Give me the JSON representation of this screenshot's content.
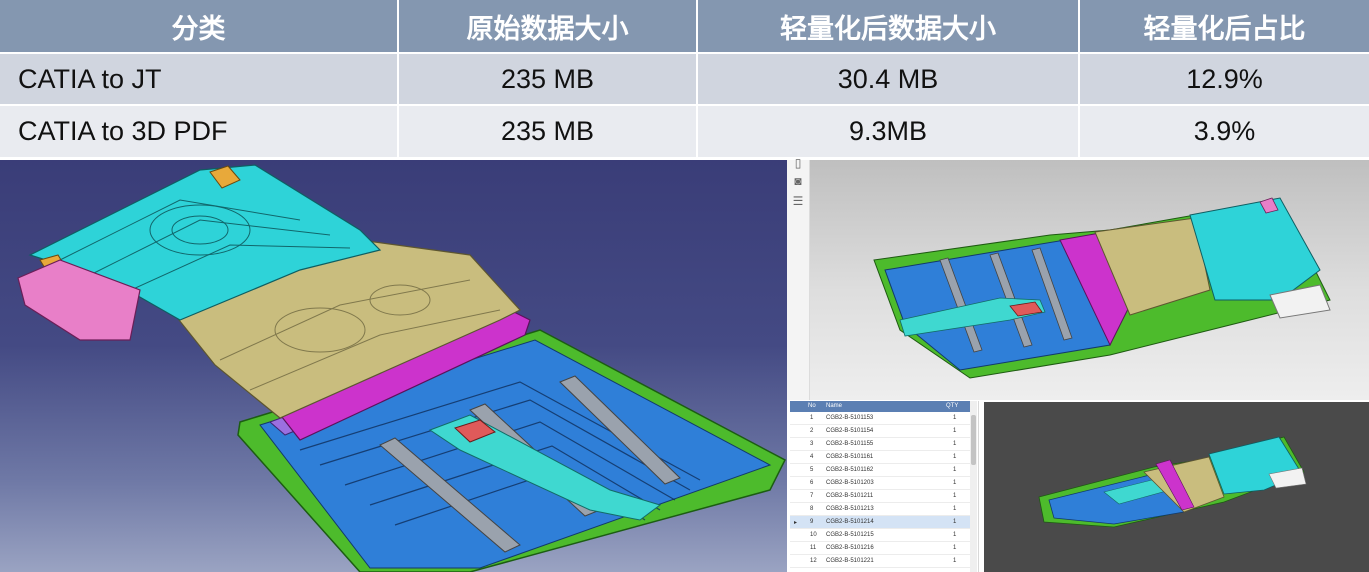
{
  "table": {
    "headers": [
      "分类",
      "原始数据大小",
      "轻量化后数据大小",
      "轻量化后占比"
    ],
    "rows": [
      [
        "CATIA to JT",
        "235 MB",
        "30.4 MB",
        "12.9%"
      ],
      [
        "CATIA to 3D PDF",
        "235 MB",
        "9.3MB",
        "3.9%"
      ]
    ]
  },
  "parts_list": {
    "columns": [
      "No",
      "Name",
      "QTY"
    ],
    "rows": [
      {
        "no": "1",
        "name": "CGB2-B-5101153",
        "qty": "1"
      },
      {
        "no": "2",
        "name": "CGB2-B-5101154",
        "qty": "1"
      },
      {
        "no": "3",
        "name": "CGB2-B-5101155",
        "qty": "1"
      },
      {
        "no": "4",
        "name": "CGB2-B-5101161",
        "qty": "1"
      },
      {
        "no": "5",
        "name": "CGB2-B-5101162",
        "qty": "1"
      },
      {
        "no": "6",
        "name": "CGB2-B-5101203",
        "qty": "1"
      },
      {
        "no": "7",
        "name": "CGB2-B-5101211",
        "qty": "1"
      },
      {
        "no": "8",
        "name": "CGB2-B-5101213",
        "qty": "1"
      },
      {
        "no": "9",
        "name": "CGB2-B-5101214",
        "qty": "1",
        "selected": true
      },
      {
        "no": "10",
        "name": "CGB2-B-5101215",
        "qty": "1"
      },
      {
        "no": "11",
        "name": "CGB2-B-5101216",
        "qty": "1"
      },
      {
        "no": "12",
        "name": "CGB2-B-5101221",
        "qty": "1"
      }
    ]
  },
  "colors": {
    "header_bg": "#8497b0",
    "row1_bg": "#d0d5df",
    "row2_bg": "#e9ebf0",
    "part_cyan": "#2ed3d8",
    "part_khaki": "#c9bd7e",
    "part_magenta": "#cc33cc",
    "part_blue": "#2f7fd8",
    "part_green": "#4dbb2c",
    "part_pink": "#e87fc8"
  }
}
